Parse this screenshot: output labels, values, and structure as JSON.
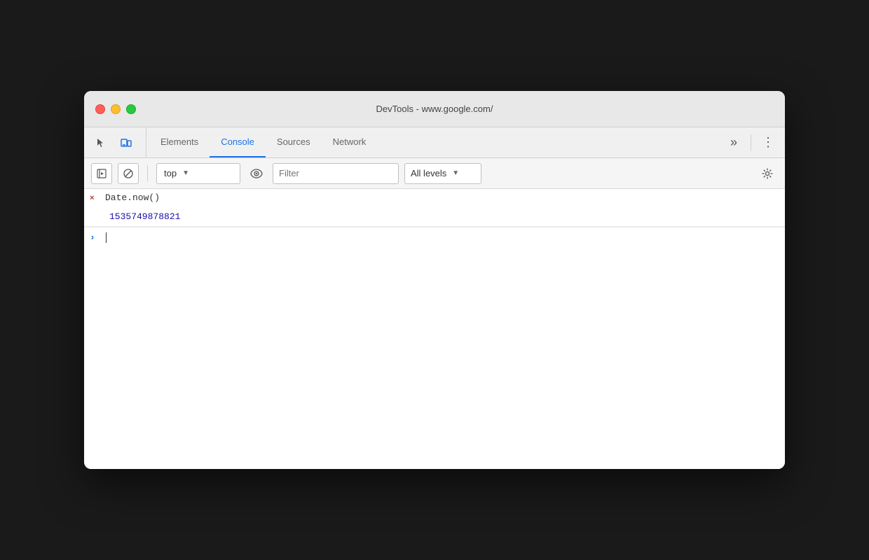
{
  "window": {
    "title": "DevTools - www.google.com/"
  },
  "traffic_lights": {
    "close": "close",
    "minimize": "minimize",
    "maximize": "maximize"
  },
  "tabs": [
    {
      "id": "elements",
      "label": "Elements",
      "active": false
    },
    {
      "id": "console",
      "label": "Console",
      "active": true
    },
    {
      "id": "sources",
      "label": "Sources",
      "active": false
    },
    {
      "id": "network",
      "label": "Network",
      "active": false
    }
  ],
  "more_tabs_label": "»",
  "kebab_label": "⋮",
  "toolbar": {
    "context_selector": {
      "value": "top",
      "placeholder": "top"
    },
    "filter_placeholder": "Filter",
    "levels_label": "All levels"
  },
  "console_entries": [
    {
      "type": "input",
      "icon": "×",
      "text": "Date.now()"
    },
    {
      "type": "output",
      "icon": "",
      "text": "1535749878821",
      "color": "number"
    }
  ],
  "input_prompt": ">"
}
